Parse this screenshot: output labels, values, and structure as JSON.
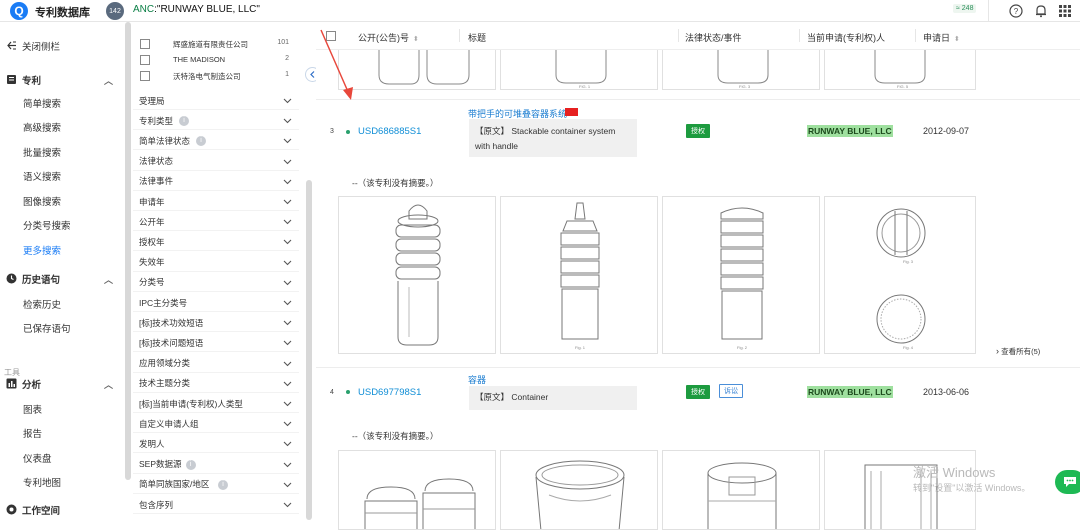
{
  "topbar": {
    "app_title": "专利数据库",
    "logo_letter": "Q",
    "badge_count": "142",
    "query_field": "ANC",
    "query_value": ":\"RUNWAY BLUE, LLC\"",
    "count_label": "≈ 248",
    "icons": [
      "help-icon",
      "bell-icon",
      "grid-icon"
    ]
  },
  "sidebar": {
    "close_label": "关闭侧栏",
    "patent_section": "专利",
    "patent_items": [
      "简单搜索",
      "高级搜索",
      "批量搜索",
      "语义搜索",
      "图像搜索",
      "分类号搜索",
      "更多搜索"
    ],
    "history_section": "历史语句",
    "history_items": [
      "检索历史",
      "已保存语句"
    ],
    "tools_label": "工具",
    "analysis_section": "分析",
    "analysis_items": [
      "图表",
      "报告",
      "仪表盘",
      "专利地图"
    ],
    "workspace_section": "工作空间",
    "active_color": "#1a7cf5"
  },
  "filters": {
    "applicants": [
      {
        "name": "辉盛施道有限责任公司",
        "count": "101"
      },
      {
        "name": "THE MADISON",
        "count": "2"
      },
      {
        "name": "沃特洛电气制造公司",
        "count": "1"
      }
    ],
    "items": [
      {
        "label": "受理局",
        "help": false
      },
      {
        "label": "专利类型",
        "help": true
      },
      {
        "label": "简单法律状态",
        "help": true
      },
      {
        "label": "法律状态",
        "help": false
      },
      {
        "label": "法律事件",
        "help": false
      },
      {
        "label": "申请年",
        "help": false
      },
      {
        "label": "公开年",
        "help": false
      },
      {
        "label": "授权年",
        "help": false
      },
      {
        "label": "失效年",
        "help": false
      },
      {
        "label": "分类号",
        "help": false
      },
      {
        "label": "IPC主分类号",
        "help": false
      },
      {
        "label": "[标]技术功效短语",
        "help": false
      },
      {
        "label": "[标]技术问题短语",
        "help": false
      },
      {
        "label": "应用领域分类",
        "help": false
      },
      {
        "label": "技术主题分类",
        "help": false
      },
      {
        "label": "[标]当前申请(专利权)人类型",
        "help": false
      },
      {
        "label": "自定义申请人组",
        "help": false
      },
      {
        "label": "发明人",
        "help": false
      },
      {
        "label": "SEP数据源",
        "help": true
      },
      {
        "label": "简单同族国家/地区",
        "help": true
      },
      {
        "label": "包含序列",
        "help": false
      }
    ]
  },
  "table": {
    "headers": {
      "pub_no": "公开(公告)号",
      "title": "标题",
      "legal": "法律状态/事件",
      "applicant": "当前申请(专利权)人",
      "date": "申请日"
    },
    "rows": [
      {
        "num": "3",
        "pub_no": "USD686885S1",
        "title": "带把手的可堆叠容器系统",
        "abstract": "【原文】 Stackable container system with handle",
        "status": "授权",
        "status2": "",
        "applicant_pre": "RUNWAY BLUE",
        "applicant_post": ", LLC",
        "date": "2012-09-07",
        "no_abstract": "--（该专利没有摘要。）",
        "view_all": "查看所有(5)",
        "figure_labels": [
          "Fig. 1",
          "Fig. 2",
          "Fig. 3",
          "Fig. 4"
        ]
      },
      {
        "num": "4",
        "pub_no": "USD697798S1",
        "title": "容器",
        "abstract": "【原文】 Container",
        "status": "授权",
        "status2": "诉讼",
        "applicant_pre": "RUNWAY BLUE",
        "applicant_post": ", LLC",
        "date": "2013-06-06",
        "no_abstract": "--（该专利没有摘要。）"
      }
    ]
  },
  "watermark": {
    "line1": "激活 Windows",
    "line2": "转到\"设置\"以激活 Windows。"
  }
}
